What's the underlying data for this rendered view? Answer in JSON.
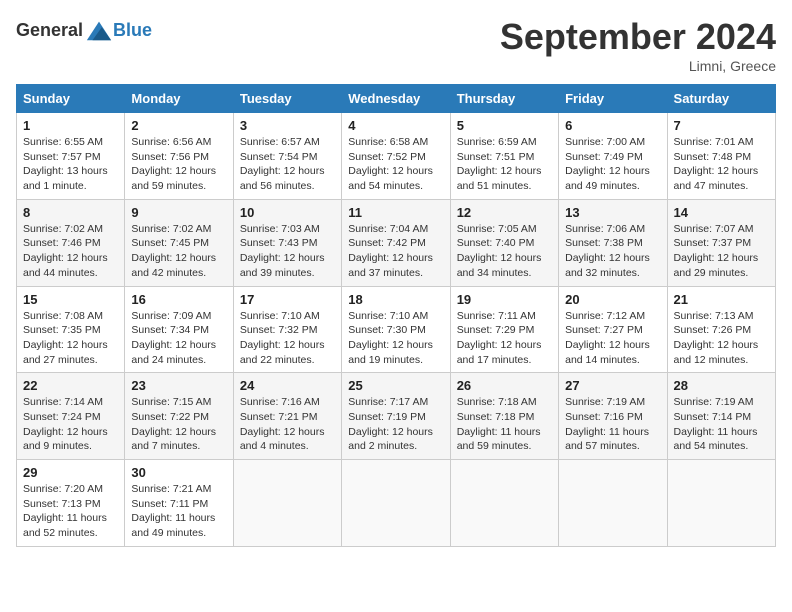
{
  "header": {
    "logo_general": "General",
    "logo_blue": "Blue",
    "title": "September 2024",
    "location": "Limni, Greece"
  },
  "days_of_week": [
    "Sunday",
    "Monday",
    "Tuesday",
    "Wednesday",
    "Thursday",
    "Friday",
    "Saturday"
  ],
  "weeks": [
    [
      {
        "day": "1",
        "info": "Sunrise: 6:55 AM\nSunset: 7:57 PM\nDaylight: 13 hours\nand 1 minute."
      },
      {
        "day": "2",
        "info": "Sunrise: 6:56 AM\nSunset: 7:56 PM\nDaylight: 12 hours\nand 59 minutes."
      },
      {
        "day": "3",
        "info": "Sunrise: 6:57 AM\nSunset: 7:54 PM\nDaylight: 12 hours\nand 56 minutes."
      },
      {
        "day": "4",
        "info": "Sunrise: 6:58 AM\nSunset: 7:52 PM\nDaylight: 12 hours\nand 54 minutes."
      },
      {
        "day": "5",
        "info": "Sunrise: 6:59 AM\nSunset: 7:51 PM\nDaylight: 12 hours\nand 51 minutes."
      },
      {
        "day": "6",
        "info": "Sunrise: 7:00 AM\nSunset: 7:49 PM\nDaylight: 12 hours\nand 49 minutes."
      },
      {
        "day": "7",
        "info": "Sunrise: 7:01 AM\nSunset: 7:48 PM\nDaylight: 12 hours\nand 47 minutes."
      }
    ],
    [
      {
        "day": "8",
        "info": "Sunrise: 7:02 AM\nSunset: 7:46 PM\nDaylight: 12 hours\nand 44 minutes."
      },
      {
        "day": "9",
        "info": "Sunrise: 7:02 AM\nSunset: 7:45 PM\nDaylight: 12 hours\nand 42 minutes."
      },
      {
        "day": "10",
        "info": "Sunrise: 7:03 AM\nSunset: 7:43 PM\nDaylight: 12 hours\nand 39 minutes."
      },
      {
        "day": "11",
        "info": "Sunrise: 7:04 AM\nSunset: 7:42 PM\nDaylight: 12 hours\nand 37 minutes."
      },
      {
        "day": "12",
        "info": "Sunrise: 7:05 AM\nSunset: 7:40 PM\nDaylight: 12 hours\nand 34 minutes."
      },
      {
        "day": "13",
        "info": "Sunrise: 7:06 AM\nSunset: 7:38 PM\nDaylight: 12 hours\nand 32 minutes."
      },
      {
        "day": "14",
        "info": "Sunrise: 7:07 AM\nSunset: 7:37 PM\nDaylight: 12 hours\nand 29 minutes."
      }
    ],
    [
      {
        "day": "15",
        "info": "Sunrise: 7:08 AM\nSunset: 7:35 PM\nDaylight: 12 hours\nand 27 minutes."
      },
      {
        "day": "16",
        "info": "Sunrise: 7:09 AM\nSunset: 7:34 PM\nDaylight: 12 hours\nand 24 minutes."
      },
      {
        "day": "17",
        "info": "Sunrise: 7:10 AM\nSunset: 7:32 PM\nDaylight: 12 hours\nand 22 minutes."
      },
      {
        "day": "18",
        "info": "Sunrise: 7:10 AM\nSunset: 7:30 PM\nDaylight: 12 hours\nand 19 minutes."
      },
      {
        "day": "19",
        "info": "Sunrise: 7:11 AM\nSunset: 7:29 PM\nDaylight: 12 hours\nand 17 minutes."
      },
      {
        "day": "20",
        "info": "Sunrise: 7:12 AM\nSunset: 7:27 PM\nDaylight: 12 hours\nand 14 minutes."
      },
      {
        "day": "21",
        "info": "Sunrise: 7:13 AM\nSunset: 7:26 PM\nDaylight: 12 hours\nand 12 minutes."
      }
    ],
    [
      {
        "day": "22",
        "info": "Sunrise: 7:14 AM\nSunset: 7:24 PM\nDaylight: 12 hours\nand 9 minutes."
      },
      {
        "day": "23",
        "info": "Sunrise: 7:15 AM\nSunset: 7:22 PM\nDaylight: 12 hours\nand 7 minutes."
      },
      {
        "day": "24",
        "info": "Sunrise: 7:16 AM\nSunset: 7:21 PM\nDaylight: 12 hours\nand 4 minutes."
      },
      {
        "day": "25",
        "info": "Sunrise: 7:17 AM\nSunset: 7:19 PM\nDaylight: 12 hours\nand 2 minutes."
      },
      {
        "day": "26",
        "info": "Sunrise: 7:18 AM\nSunset: 7:18 PM\nDaylight: 11 hours\nand 59 minutes."
      },
      {
        "day": "27",
        "info": "Sunrise: 7:19 AM\nSunset: 7:16 PM\nDaylight: 11 hours\nand 57 minutes."
      },
      {
        "day": "28",
        "info": "Sunrise: 7:19 AM\nSunset: 7:14 PM\nDaylight: 11 hours\nand 54 minutes."
      }
    ],
    [
      {
        "day": "29",
        "info": "Sunrise: 7:20 AM\nSunset: 7:13 PM\nDaylight: 11 hours\nand 52 minutes."
      },
      {
        "day": "30",
        "info": "Sunrise: 7:21 AM\nSunset: 7:11 PM\nDaylight: 11 hours\nand 49 minutes."
      },
      {
        "day": "",
        "info": ""
      },
      {
        "day": "",
        "info": ""
      },
      {
        "day": "",
        "info": ""
      },
      {
        "day": "",
        "info": ""
      },
      {
        "day": "",
        "info": ""
      }
    ]
  ]
}
